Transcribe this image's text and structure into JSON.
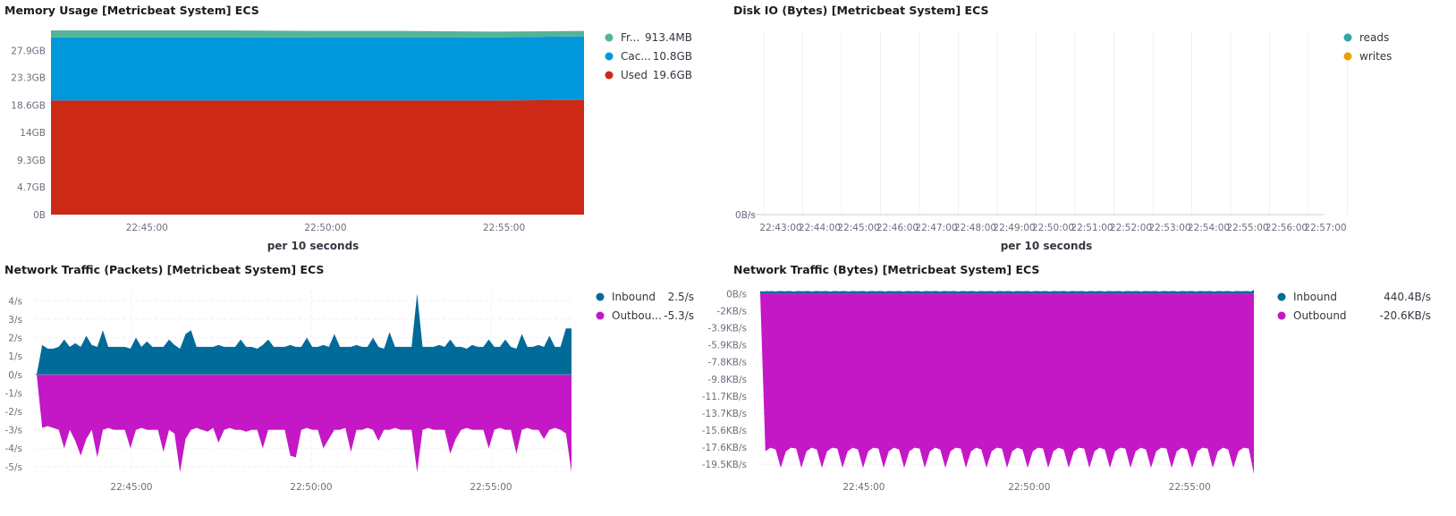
{
  "panels": [
    {
      "id": "mem",
      "title": "Memory Usage [Metricbeat System] ECS",
      "xlabel": "per 10 seconds"
    },
    {
      "id": "disk",
      "title": "Disk IO (Bytes) [Metricbeat System] ECS",
      "xlabel": "per 10 seconds"
    },
    {
      "id": "pkt",
      "title": "Network Traffic (Packets) [Metricbeat System] ECS",
      "xlabel": ""
    },
    {
      "id": "bytes",
      "title": "Network Traffic (Bytes) [Metricbeat System] ECS",
      "xlabel": ""
    }
  ],
  "chart_data": [
    {
      "type": "area",
      "title": "Memory Usage [Metricbeat System] ECS",
      "xlabel": "per 10 seconds",
      "x_ticks": [
        "22:45:00",
        "22:50:00",
        "22:55:00"
      ],
      "y_ticks": [
        "0B",
        "4.7GB",
        "9.3GB",
        "14GB",
        "18.6GB",
        "23.3GB",
        "27.9GB"
      ],
      "ylim": [
        0,
        31.3
      ],
      "stacked": true,
      "legend_position": "right",
      "series": [
        {
          "name": "Used",
          "legend_label": "Used",
          "value_label": "19.6GB",
          "color": "#cc2916",
          "values": [
            19.4,
            19.4,
            19.4,
            19.4,
            19.4,
            19.4,
            19.5
          ]
        },
        {
          "name": "Cached",
          "legend_label": "Cac...",
          "value_label": "10.8GB",
          "color": "#0098db",
          "values": [
            10.7,
            10.7,
            10.7,
            10.7,
            10.7,
            10.7,
            10.8
          ]
        },
        {
          "name": "Free",
          "legend_label": "Fr...",
          "value_label": "913.4MB",
          "color": "#54b399",
          "values": [
            1.2,
            1.2,
            1.2,
            1.1,
            1.1,
            1.0,
            0.9
          ]
        }
      ]
    },
    {
      "type": "line",
      "title": "Disk IO (Bytes) [Metricbeat System] ECS",
      "xlabel": "per 10 seconds",
      "x_ticks": [
        "22:43:00",
        "22:44:00",
        "22:45:00",
        "22:46:00",
        "22:47:00",
        "22:48:00",
        "22:49:00",
        "22:50:00",
        "22:51:00",
        "22:52:00",
        "22:53:00",
        "22:54:00",
        "22:55:00",
        "22:56:00",
        "22:57:00"
      ],
      "y_ticks": [
        "0B/s"
      ],
      "grid": true,
      "legend_position": "right",
      "series": [
        {
          "name": "reads",
          "color": "#36a2a2",
          "values": []
        },
        {
          "name": "writes",
          "color": "#e7a100",
          "values": []
        }
      ]
    },
    {
      "type": "area",
      "title": "Network Traffic (Packets) [Metricbeat System] ECS",
      "x_ticks": [
        "22:45:00",
        "22:50:00",
        "22:55:00"
      ],
      "y_ticks": [
        "4/s",
        "3/s",
        "2/s",
        "1/s",
        "0/s",
        "-1/s",
        "-2/s",
        "-3/s",
        "-4/s",
        "-5/s"
      ],
      "ylim": [
        -5.3,
        4.6
      ],
      "grid": true,
      "legend_position": "right",
      "series": [
        {
          "name": "Inbound",
          "legend_label": "Inbound",
          "value_label": "2.5/s",
          "color": "#006b99",
          "values": [
            0,
            1.6,
            1.4,
            1.4,
            1.5,
            1.9,
            1.5,
            1.7,
            1.5,
            2.1,
            1.6,
            1.5,
            2.4,
            1.5,
            1.5,
            1.5,
            1.5,
            1.4,
            2.0,
            1.5,
            1.8,
            1.5,
            1.5,
            1.5,
            1.9,
            1.6,
            1.4,
            2.2,
            2.4,
            1.5,
            1.5,
            1.5,
            1.5,
            1.6,
            1.5,
            1.5,
            1.5,
            1.9,
            1.5,
            1.5,
            1.4,
            1.6,
            1.9,
            1.5,
            1.5,
            1.5,
            1.6,
            1.5,
            1.5,
            2.0,
            1.5,
            1.5,
            1.6,
            1.5,
            2.2,
            1.5,
            1.5,
            1.5,
            1.6,
            1.5,
            1.5,
            2.0,
            1.5,
            1.4,
            2.3,
            1.5,
            1.5,
            1.5,
            1.5,
            4.4,
            1.5,
            1.5,
            1.5,
            1.6,
            1.5,
            1.9,
            1.5,
            1.5,
            1.4,
            1.6,
            1.5,
            1.5,
            1.9,
            1.5,
            1.5,
            1.9,
            1.5,
            1.4,
            2.2,
            1.5,
            1.5,
            1.6,
            1.5,
            2.1,
            1.5,
            1.5,
            2.5,
            2.5
          ]
        },
        {
          "name": "Outbound",
          "legend_label": "Outbou...",
          "value_label": "-5.3/s",
          "color": "#c417c6",
          "values": [
            0,
            -2.9,
            -2.8,
            -2.9,
            -3.0,
            -4.0,
            -3.0,
            -3.6,
            -4.4,
            -3.5,
            -3.0,
            -4.5,
            -3.0,
            -2.9,
            -3.0,
            -3.0,
            -3.0,
            -4.0,
            -3.0,
            -2.9,
            -3.0,
            -3.0,
            -3.0,
            -4.2,
            -3.0,
            -3.2,
            -5.3,
            -3.5,
            -3.0,
            -2.9,
            -3.0,
            -3.1,
            -2.9,
            -3.7,
            -3.0,
            -2.9,
            -3.0,
            -3.0,
            -3.1,
            -3.0,
            -3.0,
            -4.0,
            -3.0,
            -3.0,
            -3.0,
            -3.0,
            -4.4,
            -4.5,
            -3.0,
            -2.9,
            -3.0,
            -3.0,
            -4.0,
            -3.5,
            -3.0,
            -3.0,
            -2.9,
            -4.2,
            -3.0,
            -3.0,
            -2.9,
            -3.0,
            -3.6,
            -3.0,
            -3.0,
            -2.9,
            -3.0,
            -3.0,
            -3.0,
            -5.3,
            -3.0,
            -2.9,
            -3.0,
            -3.0,
            -3.0,
            -4.3,
            -3.5,
            -3.0,
            -2.9,
            -3.0,
            -3.0,
            -3.0,
            -4.0,
            -3.0,
            -2.9,
            -3.0,
            -3.0,
            -4.3,
            -3.0,
            -2.9,
            -3.0,
            -3.0,
            -3.5,
            -3.0,
            -2.9,
            -3.0,
            -3.2,
            -5.3
          ]
        }
      ]
    },
    {
      "type": "area",
      "title": "Network Traffic (Bytes) [Metricbeat System] ECS",
      "x_ticks": [
        "22:45:00",
        "22:50:00",
        "22:55:00"
      ],
      "y_ticks": [
        "0B/s",
        "-2KB/s",
        "-3.9KB/s",
        "-5.9KB/s",
        "-7.8KB/s",
        "-9.8KB/s",
        "-11.7KB/s",
        "-13.7KB/s",
        "-15.6KB/s",
        "-17.6KB/s",
        "-19.5KB/s"
      ],
      "ylim_kb": [
        -20.6,
        0.45
      ],
      "grid": true,
      "legend_position": "right",
      "series": [
        {
          "name": "Inbound",
          "legend_label": "Inbound",
          "value_label": "440.4B/s",
          "color": "#006b99",
          "values_kb": [
            0.3,
            0.25,
            0.3,
            0.28,
            0.3,
            0.25,
            0.3,
            0.3,
            0.28,
            0.3,
            0.3,
            0.25,
            0.3,
            0.3,
            0.28,
            0.3,
            0.3,
            0.25,
            0.3,
            0.3,
            0.28,
            0.3,
            0.3,
            0.25,
            0.3,
            0.3,
            0.28,
            0.3,
            0.3,
            0.25,
            0.3,
            0.3,
            0.28,
            0.3,
            0.3,
            0.25,
            0.3,
            0.3,
            0.28,
            0.3,
            0.3,
            0.25,
            0.3,
            0.3,
            0.28,
            0.3,
            0.3,
            0.25,
            0.3,
            0.3,
            0.28,
            0.3,
            0.3,
            0.25,
            0.3,
            0.3,
            0.28,
            0.3,
            0.3,
            0.25,
            0.3,
            0.3,
            0.28,
            0.3,
            0.3,
            0.25,
            0.3,
            0.3,
            0.28,
            0.3,
            0.3,
            0.25,
            0.3,
            0.3,
            0.28,
            0.3,
            0.3,
            0.25,
            0.3,
            0.3,
            0.28,
            0.3,
            0.3,
            0.25,
            0.3,
            0.3,
            0.28,
            0.3,
            0.3,
            0.25,
            0.3,
            0.3,
            0.28,
            0.3,
            0.3,
            0.25,
            0.3,
            0.3,
            0.28,
            0.3,
            0.3,
            0.25,
            0.3,
            0.3,
            0.28,
            0.3,
            0.3,
            0.25,
            0.3,
            0.3,
            0.28,
            0.3,
            0.3,
            0.25,
            0.3,
            0.3,
            0.28,
            0.3,
            0.3,
            0.25,
            0.3,
            0.3,
            0.28,
            0.3,
            0.3,
            0.25,
            0.3,
            0.3,
            0.28,
            0.3,
            0.3,
            0.25,
            0.3,
            0.3,
            0.28,
            0.3,
            0.3,
            0.25,
            0.3,
            0.3,
            0.28,
            0.3,
            0.3,
            0.25,
            0.3,
            0.3,
            0.28,
            0.3,
            0.3,
            0.25,
            0.3,
            0.3,
            0.28,
            0.3,
            0.3,
            0.25,
            0.3,
            0.3,
            0.28,
            0.3,
            0.3,
            0.25,
            0.44
          ]
        },
        {
          "name": "Outbound",
          "legend_label": "Outbound",
          "value_label": "-20.6KB/s",
          "color": "#c417c6",
          "values_kb": [
            0,
            -18.0,
            -17.6,
            -17.8,
            -19.9,
            -18.0,
            -17.6,
            -17.7,
            -19.9,
            -18.0,
            -17.6,
            -17.8,
            -19.9,
            -18.0,
            -17.6,
            -17.7,
            -19.9,
            -18.0,
            -17.6,
            -17.8,
            -19.9,
            -18.0,
            -17.6,
            -17.7,
            -19.9,
            -18.0,
            -17.6,
            -17.8,
            -19.9,
            -18.0,
            -17.6,
            -17.7,
            -19.9,
            -18.0,
            -17.6,
            -17.8,
            -19.9,
            -18.0,
            -17.6,
            -17.7,
            -19.9,
            -18.0,
            -17.6,
            -17.8,
            -19.9,
            -18.0,
            -17.6,
            -17.7,
            -19.9,
            -18.0,
            -17.6,
            -17.8,
            -19.9,
            -18.0,
            -17.6,
            -17.7,
            -19.9,
            -18.0,
            -17.6,
            -17.8,
            -19.9,
            -18.0,
            -17.6,
            -17.7,
            -19.9,
            -18.0,
            -17.6,
            -17.8,
            -19.9,
            -18.0,
            -17.6,
            -17.7,
            -19.9,
            -18.0,
            -17.6,
            -17.8,
            -19.9,
            -18.0,
            -17.6,
            -17.7,
            -19.9,
            -18.0,
            -17.6,
            -17.8,
            -19.9,
            -18.0,
            -17.6,
            -17.7,
            -19.9,
            -18.0,
            -17.6,
            -17.8,
            -19.9,
            -18.0,
            -17.6,
            -17.7,
            -20.6
          ]
        }
      ]
    }
  ]
}
